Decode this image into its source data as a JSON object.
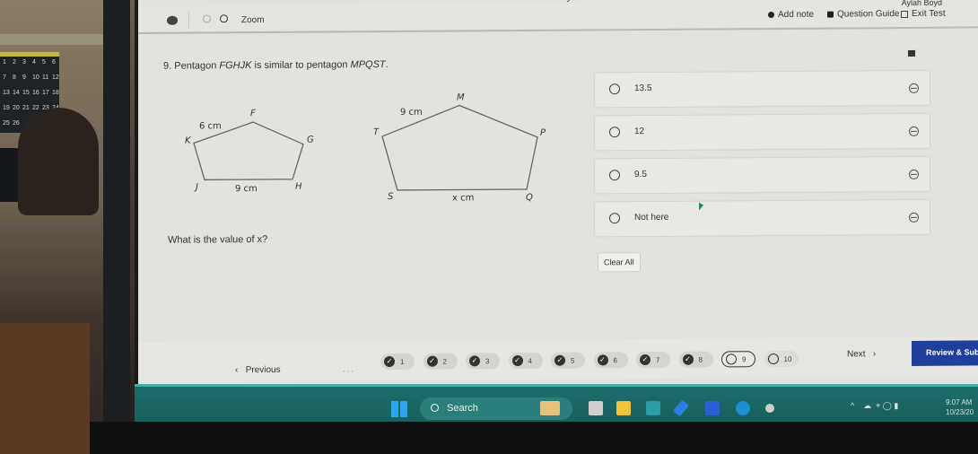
{
  "notification": "...from Keyan Carter",
  "toolbar": {
    "zoom_label": "Zoom",
    "user_name": "Aylah Boyd",
    "add_note": "Add note",
    "question_guide": "Question Guide",
    "exit_test": "Exit Test"
  },
  "question": {
    "number": "9.",
    "text_pre": "Pentagon ",
    "shape1": "FGHJK",
    "text_mid": " is similar to pentagon ",
    "shape2": "MPQST",
    "text_post": ".",
    "prompt": "What is the value of x?",
    "figure1": {
      "vertices": [
        "F",
        "G",
        "H",
        "J",
        "K"
      ],
      "side_top": "6 cm",
      "side_bottom": "9 cm"
    },
    "figure2": {
      "vertices": [
        "M",
        "P",
        "Q",
        "S",
        "T"
      ],
      "side_top": "9 cm",
      "side_bottom": "x cm"
    }
  },
  "choices": [
    {
      "label": "13.5"
    },
    {
      "label": "12"
    },
    {
      "label": "9.5"
    },
    {
      "label": "Not here"
    }
  ],
  "clear_all": "Clear All",
  "nav": {
    "previous": "Previous",
    "ellipsis": "...",
    "next": "Next",
    "review_submit": "Review & Submit",
    "questions": [
      {
        "num": "1",
        "state": "answered"
      },
      {
        "num": "2",
        "state": "answered"
      },
      {
        "num": "3",
        "state": "answered"
      },
      {
        "num": "4",
        "state": "answered"
      },
      {
        "num": "5",
        "state": "answered"
      },
      {
        "num": "6",
        "state": "answered"
      },
      {
        "num": "7",
        "state": "answered"
      },
      {
        "num": "8",
        "state": "answered"
      },
      {
        "num": "9",
        "state": "current"
      },
      {
        "num": "10",
        "state": "unanswered"
      }
    ]
  },
  "taskbar": {
    "search_label": "Search",
    "time": "9:07 AM",
    "date": "10/23/20"
  },
  "colors": {
    "review_button": "#1f3f9c",
    "taskbar": "#1d6f6c"
  }
}
